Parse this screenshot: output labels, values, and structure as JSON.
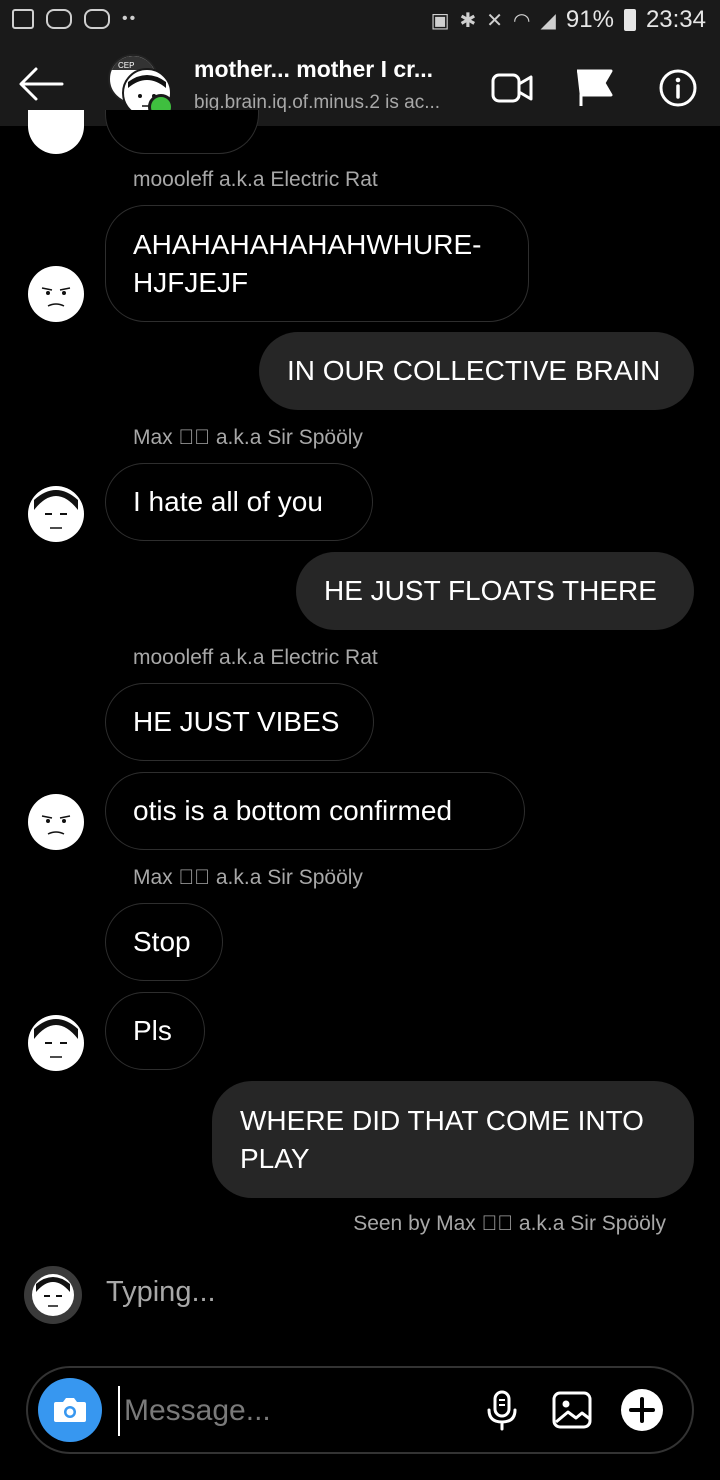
{
  "status_bar": {
    "battery_percent": "91%",
    "time": "23:34",
    "icons": [
      "gallery-icon",
      "game-controller-icon",
      "game-controller-icon",
      "more-dots-icon",
      "lock-icon",
      "bluetooth-icon",
      "mute-icon",
      "wifi-icon",
      "signal-icon",
      "battery-icon"
    ]
  },
  "header": {
    "title": "mother... mother I cr...",
    "subtitle": "big.brain.iq.of.minus.2 is ac...",
    "avatar_badge": "CEP"
  },
  "messages": {
    "m0_sender": "moooleff a.k.a Electric Rat",
    "m1_text": "AHAHAHAHAHAHWHURE-",
    "m1_text_2": "HJFJEJF",
    "m2_text": "IN OUR COLLECTIVE BRAIN",
    "m3_sender": "Max \u0000🗡 a.k.a Sir Spööly",
    "m3_text": "I hate all of you",
    "m4_text": "HE JUST FLOATS THERE",
    "m5_sender": "moooleff a.k.a Electric Rat",
    "m5_text": "HE JUST VIBES",
    "m6_text": "otis is a bottom confirmed",
    "m7_sender": "Max \u0000🗡 a.k.a Sir Spööly",
    "m7_text": "Stop",
    "m8_text": "Pls",
    "m9_text": "WHERE DID THAT COME INTO",
    "m9_text_2": "PLAY"
  },
  "seen": "Seen by Max \u0000🗡 a.k.a Sir Spööly",
  "typing": "Typing...",
  "composer": {
    "placeholder": "Message..."
  },
  "colors": {
    "accent": "#3797f0",
    "online": "#3fbf3f",
    "outgoing_bubble": "#262626",
    "secondary_text": "#a8a8a8"
  }
}
